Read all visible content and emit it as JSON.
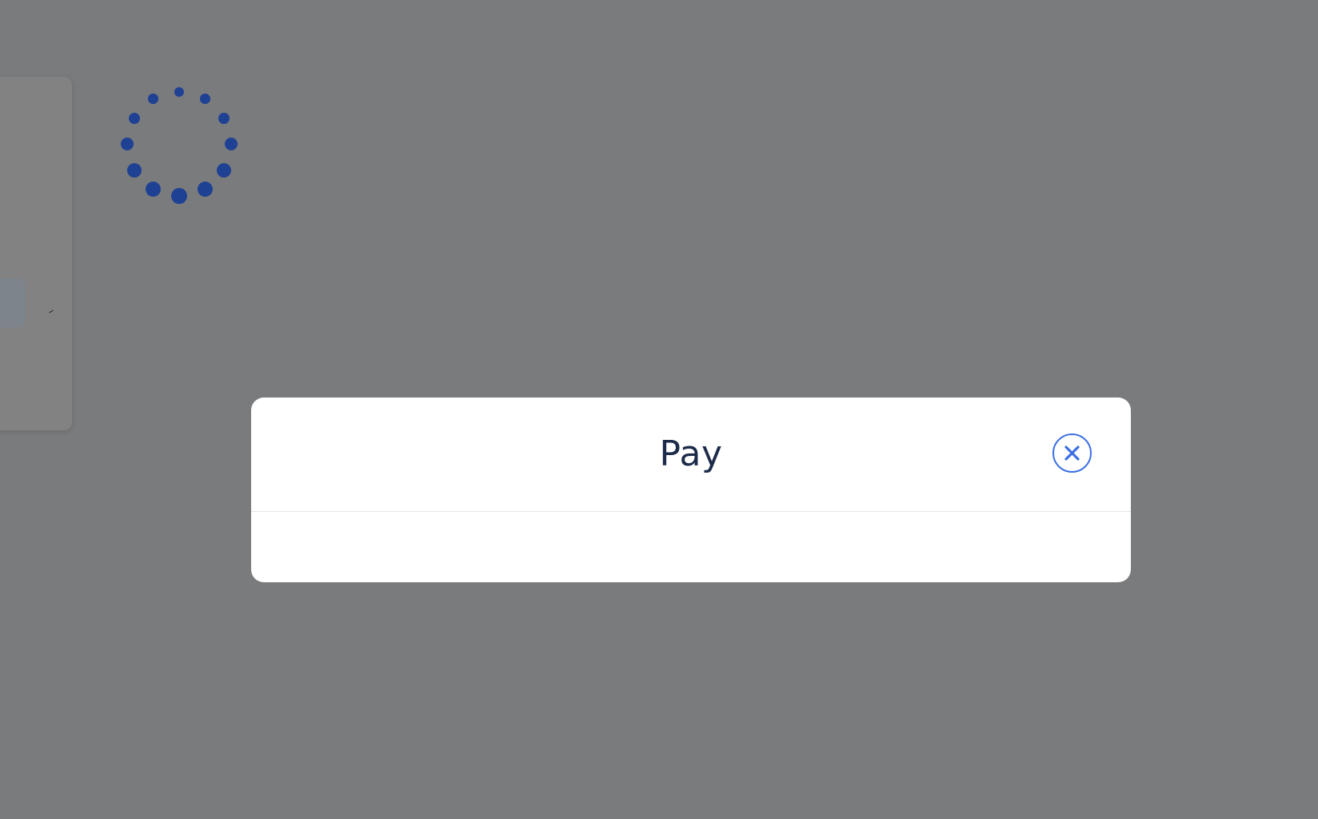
{
  "modal": {
    "title": "Pay",
    "close_icon": "close-icon"
  },
  "spinner": {
    "icon": "loading-spinner-icon"
  },
  "colors": {
    "overlay": "#7a7b7d",
    "spinner": "#1f4193",
    "accent": "#3b70e3",
    "title_text": "#1c2b4a"
  }
}
